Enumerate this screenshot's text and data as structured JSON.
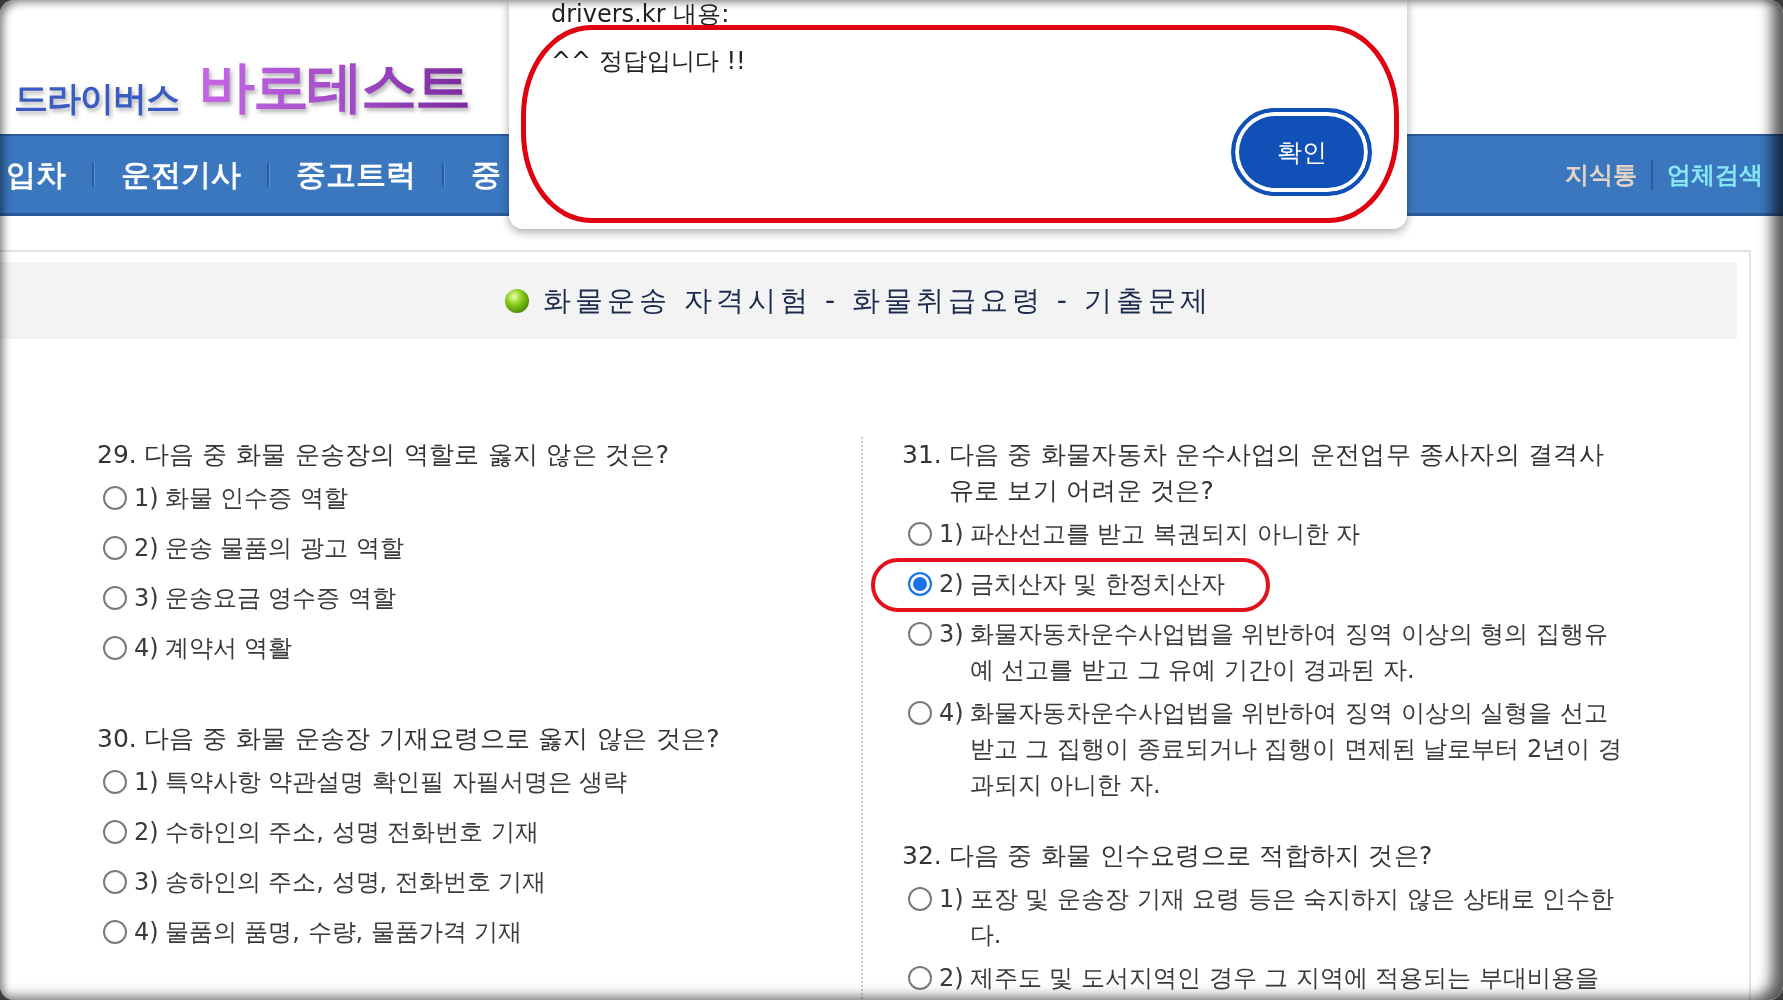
{
  "header": {
    "logo_prefix": "드라이버스",
    "logo_name": "바로테스트"
  },
  "nav": {
    "items": [
      "입차",
      "운전기사",
      "중고트럭",
      "중"
    ],
    "right_links": [
      {
        "label": "지식통",
        "color": "#e4d4c4"
      },
      {
        "label": "업체검색",
        "color": "#86e6f6"
      }
    ]
  },
  "dialog": {
    "title": "drivers.kr 내용:",
    "message": "^^ 정답입니다 !!",
    "button": "확인",
    "circled": true
  },
  "page_title": "화물운송 자격시험 - 화물취급요령 - 기출문제",
  "columns": [
    {
      "questions": [
        {
          "number": "29.",
          "text": "다음 중 화물 운송장의 역할로 옳지 않은 것은?",
          "options": [
            {
              "number": "1)",
              "text": "화물 인수증 역할",
              "selected": false,
              "circled": false
            },
            {
              "number": "2)",
              "text": "운송 물품의 광고 역할",
              "selected": false,
              "circled": false
            },
            {
              "number": "3)",
              "text": "운송요금 영수증 역할",
              "selected": false,
              "circled": false
            },
            {
              "number": "4)",
              "text": "계약서 역활",
              "selected": false,
              "circled": false
            }
          ]
        },
        {
          "number": "30.",
          "text": "다음 중 화물 운송장 기재요령으로 옳지 않은 것은?",
          "options": [
            {
              "number": "1)",
              "text": "특약사항 약관설명 확인필 자필서명은 생략",
              "selected": false,
              "circled": false
            },
            {
              "number": "2)",
              "text": "수하인의 주소, 성명 전화번호 기재",
              "selected": false,
              "circled": false
            },
            {
              "number": "3)",
              "text": "송하인의 주소, 성명, 전화번호 기재",
              "selected": false,
              "circled": false
            },
            {
              "number": "4)",
              "text": "물품의 품명, 수량, 물품가격 기재",
              "selected": false,
              "circled": false
            }
          ]
        }
      ]
    },
    {
      "questions": [
        {
          "number": "31.",
          "text": "다음 중 화물자동차 운수사업의 운전업무 종사자의 결격사유로 보기 어려운 것은?",
          "options": [
            {
              "number": "1)",
              "text": "파산선고를 받고 복권되지 아니한 자",
              "selected": false,
              "circled": false
            },
            {
              "number": "2)",
              "text": "금치산자 및 한정치산자",
              "selected": true,
              "circled": true
            },
            {
              "number": "3)",
              "text": "화물자동차운수사업법을 위반하여 징역 이상의 형의 집행유예 선고를 받고 그 유예 기간이 경과된 자.",
              "selected": false,
              "circled": false
            },
            {
              "number": "4)",
              "text": "화물자동차운수사업법을 위반하여 징역 이상의 실형을 선고받고 그 집행이 종료되거나 집행이 면제된 날로부터 2년이 경과되지 아니한 자.",
              "selected": false,
              "circled": false
            }
          ]
        },
        {
          "number": "32.",
          "text": "다음 중 화물 인수요령으로 적합하지 것은?",
          "options": [
            {
              "number": "1)",
              "text": "포장 및 운송장 기재 요령 등은 숙지하지 않은 상태로 인수한다.",
              "selected": false,
              "circled": false
            },
            {
              "number": "2)",
              "text": "제주도 및 도서지역인 경우 그 지역에 적용되는 부대비용을",
              "selected": false,
              "circled": false
            }
          ]
        }
      ]
    }
  ]
}
